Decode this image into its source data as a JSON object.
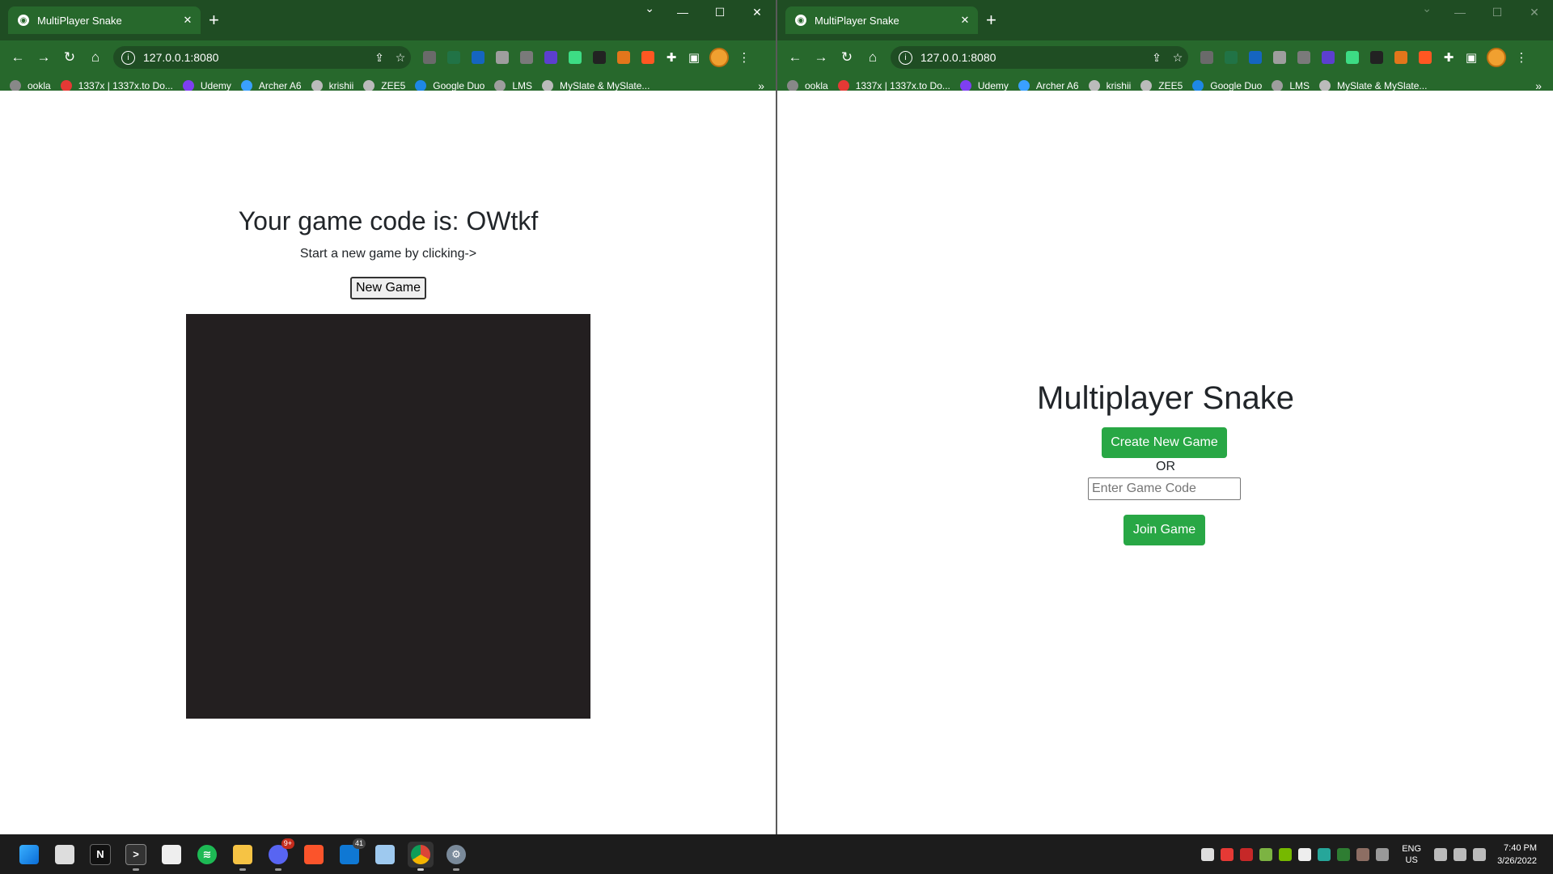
{
  "browser": {
    "tab_title": "MultiPlayer Snake",
    "url": "127.0.0.1:8080",
    "bookmarks": [
      "ookla",
      "1337x | 1337x.to Do...",
      "Udemy",
      "Archer A6",
      "krishii",
      "ZEE5",
      "Google Duo",
      "LMS",
      "MySlate & MySlate..."
    ],
    "bookmark_colors": [
      "#888888",
      "#e53935",
      "#7e3ff2",
      "#3aa0ff",
      "#bbbbbb",
      "#bbbbbb",
      "#1e88e5",
      "#9e9e9e",
      "#bbbbbb"
    ],
    "bookmarks_more": "»",
    "extension_colors": [
      "#6a6a6a",
      "#217346",
      "#1565c0",
      "#9e9e9e",
      "#7a7a7a",
      "#5c3fcf",
      "#3ddc84",
      "#222222",
      "#e2761b",
      "#ff5722"
    ]
  },
  "left_page": {
    "title": "Your game code is: OWtkf",
    "hint": "Start a new game by clicking->",
    "new_game_label": "New Game"
  },
  "right_page": {
    "heading": "Multiplayer Snake",
    "create_label": "Create New Game",
    "or_text": "OR",
    "code_placeholder": "Enter Game Code",
    "join_label": "Join Game"
  },
  "taskbar": {
    "discord_badge": "9+",
    "mail_badge": "41",
    "lang_line1": "ENG",
    "lang_line2": "US",
    "time": "7:40 PM",
    "date": "3/26/2022"
  }
}
